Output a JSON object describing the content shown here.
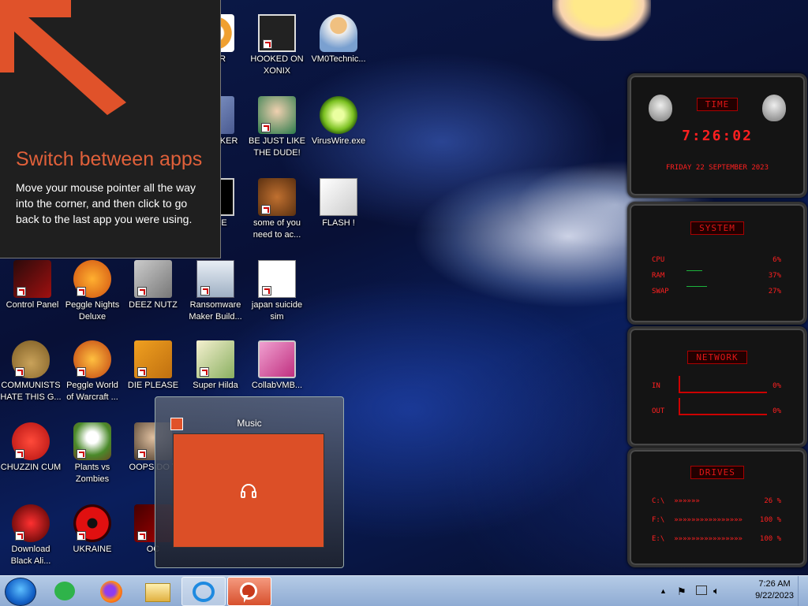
{
  "tip": {
    "title": "Switch between apps",
    "body": "Move your mouse pointer all the way into the corner, and then click to go back to the last app you were using."
  },
  "desktop_icons": [
    {
      "label": "ITOR"
    },
    {
      "label": "HOOKED ON XONIX"
    },
    {
      "label": "VM0Technic..."
    },
    {
      "label": "CARD KER"
    },
    {
      "label": "BE JUST LIKE THE DUDE!"
    },
    {
      "label": "VirusWire.exe"
    },
    {
      "label": "YPSE"
    },
    {
      "label": "some of you need to ac..."
    },
    {
      "label": "FLASH !"
    },
    {
      "label": "Control Panel"
    },
    {
      "label": "Peggle Nights Deluxe"
    },
    {
      "label": "DEEZ NUTZ"
    },
    {
      "label": "Ransomware Maker Build..."
    },
    {
      "label": "japan suicide sim"
    },
    {
      "label": "COMMUNISTS HATE THIS G..."
    },
    {
      "label": "Peggle World of Warcraft ..."
    },
    {
      "label": "DIE PLEASE"
    },
    {
      "label": "Super Hilda"
    },
    {
      "label": "CollabVMB..."
    },
    {
      "label": "CHUZZIN CUM"
    },
    {
      "label": "Plants vs Zombies"
    },
    {
      "label": "OOPS DO T"
    },
    {
      "label": "Download Black Ali..."
    },
    {
      "label": "UKRAINE"
    },
    {
      "label": "OC"
    }
  ],
  "thumbnail": {
    "title": "Music"
  },
  "widgets": {
    "time": {
      "title": "TIME",
      "clock": "7:26:02",
      "date": "FRIDAY 22 SEPTEMBER 2023"
    },
    "system": {
      "title": "SYSTEM",
      "rows": [
        {
          "label": "CPU",
          "value": "6%"
        },
        {
          "label": "RAM",
          "value": "37%"
        },
        {
          "label": "SWAP",
          "value": "27%"
        }
      ]
    },
    "network": {
      "title": "NETWORK",
      "rows": [
        {
          "label": "IN",
          "value": "0%"
        },
        {
          "label": "OUT",
          "value": "0%"
        }
      ]
    },
    "drives": {
      "title": "DRIVES",
      "rows": [
        {
          "label": "C:\\",
          "value": "26 %"
        },
        {
          "label": "F:\\",
          "value": "100 %"
        },
        {
          "label": "E:\\",
          "value": "100 %"
        }
      ]
    }
  },
  "taskbar": {
    "time": "7:26 AM",
    "date": "9/22/2023"
  },
  "colors": {
    "accent": "#dc4f27",
    "widget_red": "#e01616",
    "taskbar": "#a3bde0"
  }
}
